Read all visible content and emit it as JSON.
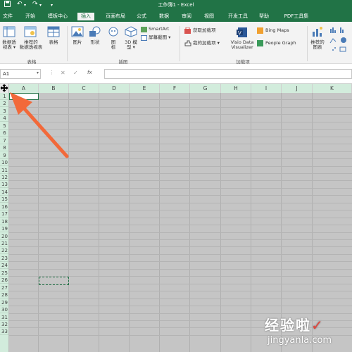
{
  "titlebar": {
    "title": "工作簿1  -  Excel",
    "undo": "↶",
    "redo": "↷"
  },
  "tabs": [
    "文件",
    "开始",
    "模板中心",
    "插入",
    "页面布局",
    "公式",
    "数据",
    "审阅",
    "视图",
    "开发工具",
    "帮助",
    "PDF工具集"
  ],
  "active_tab": "插入",
  "ribbon": {
    "pivot_rec_line1": "数据透",
    "pivot_rec_line2": "视表 ▾",
    "pivot_line1": "推荐的",
    "pivot_line2": "数据透视表",
    "table": "表格",
    "group_tables": "表格",
    "pictures": "图片",
    "shapes": "形状",
    "icons_line1": "图",
    "icons_line2": "标",
    "models_line1": "3D 模",
    "models_line2": "型 ▾",
    "smartart": "SmartArt",
    "screenshot": "屏幕截图 ▾",
    "group_illustrations": "插图",
    "get_addins": "获取加载项",
    "my_addins": "我的加载项 ▾",
    "visio_line1": "Visio Data",
    "visio_line2": "Visualizer",
    "bing_maps": "Bing Maps",
    "people_graph": "People Graph",
    "group_addins": "加载项",
    "rec_charts_line1": "推荐的",
    "rec_charts_line2": "图表"
  },
  "formula_bar": {
    "name_box": "A1",
    "cancel": "✕",
    "enter": "✓",
    "fx": "fx",
    "formula": ""
  },
  "columns": [
    "A",
    "B",
    "C",
    "D",
    "E",
    "F",
    "G",
    "H",
    "I",
    "J",
    "K"
  ],
  "rows": [
    "1",
    "2",
    "3",
    "4",
    "5",
    "6",
    "7",
    "8",
    "9",
    "10",
    "11",
    "12",
    "13",
    "14",
    "15",
    "16",
    "17",
    "18",
    "19",
    "20",
    "21",
    "22",
    "23",
    "24",
    "25",
    "26",
    "27",
    "28",
    "29",
    "30",
    "31",
    "32",
    "33"
  ],
  "watermark": {
    "cn": "经验啦",
    "check": "✓",
    "url": "jingyanla.com"
  },
  "colors": {
    "excel_green": "#217346",
    "selected_header": "#d2ecdc",
    "arrow": "#f2693a"
  }
}
